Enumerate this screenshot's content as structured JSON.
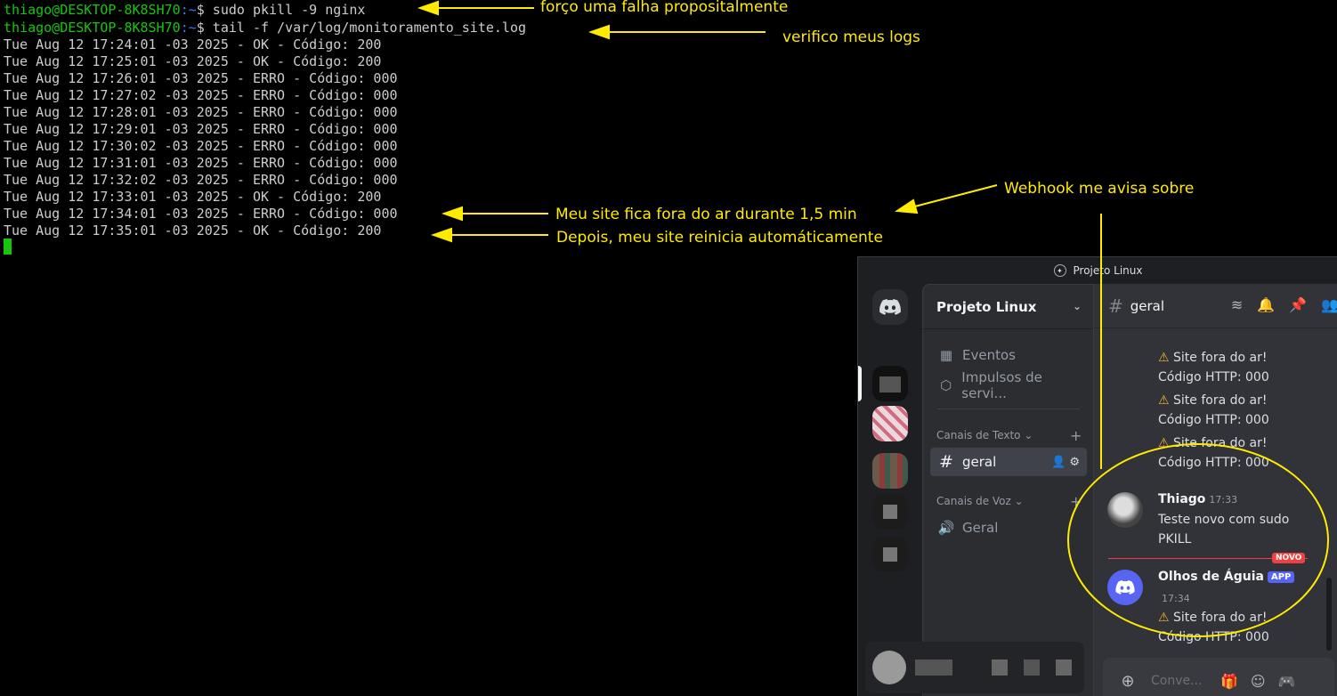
{
  "terminal": {
    "lines": [
      {
        "user": "thiago@DESKTOP-8K8SH70",
        "path": ":~",
        "cmd": "$ sudo pkill -9 nginx"
      },
      {
        "user": "thiago@DESKTOP-8K8SH70",
        "path": ":~",
        "cmd": "$ tail -f /var/log/monitoramento_site.log"
      }
    ],
    "logs": [
      "Tue Aug 12 17:24:01 -03 2025 - OK - Código: 200",
      "Tue Aug 12 17:25:01 -03 2025 - OK - Código: 200",
      "Tue Aug 12 17:26:01 -03 2025 - ERRO - Código: 000",
      "Tue Aug 12 17:27:02 -03 2025 - ERRO - Código: 000",
      "Tue Aug 12 17:28:01 -03 2025 - ERRO - Código: 000",
      "Tue Aug 12 17:29:01 -03 2025 - ERRO - Código: 000",
      "Tue Aug 12 17:30:02 -03 2025 - ERRO - Código: 000",
      "Tue Aug 12 17:31:01 -03 2025 - ERRO - Código: 000",
      "Tue Aug 12 17:32:02 -03 2025 - ERRO - Código: 000",
      "Tue Aug 12 17:33:01 -03 2025 - OK - Código: 200",
      "Tue Aug 12 17:34:01 -03 2025 - ERRO - Código: 000",
      "Tue Aug 12 17:35:01 -03 2025 - OK - Código: 200"
    ]
  },
  "annotations": {
    "pkill": "forço uma falha propositalmente",
    "logs": "verifico meus logs",
    "offline": "Meu site fica fora do ar durante 1,5 min",
    "webhook": "Webhook me avisa sobre",
    "restart": "Depois, meu site reinicia automáticamente"
  },
  "discord": {
    "window_title": "Projeto Linux",
    "server_name": "Projeto Linux",
    "nav": {
      "events": "Eventos",
      "boosts": "Impulsos de servi..."
    },
    "text_category": "Canais de Texto",
    "voice_category": "Canais de Voz",
    "text_channel": "geral",
    "voice_channel": "Geral",
    "chat_channel": "geral",
    "alert_title": "Site fora do ar!",
    "alert_code": "Código HTTP: 000",
    "message1": {
      "author": "Thiago",
      "time": "17:33",
      "line1": "Teste novo com sudo",
      "line2": "PKILL"
    },
    "new_badge": "NOVO",
    "message2": {
      "author": "Olhos de Águia",
      "badge": "APP",
      "time": "17:34"
    },
    "composer_placeholder": "Conve..."
  },
  "colors": {
    "annotation": "#ffeb00",
    "prompt_user": "#16c60c",
    "prompt_path": "#3b78ff",
    "discord_blurple": "#5865f2"
  }
}
